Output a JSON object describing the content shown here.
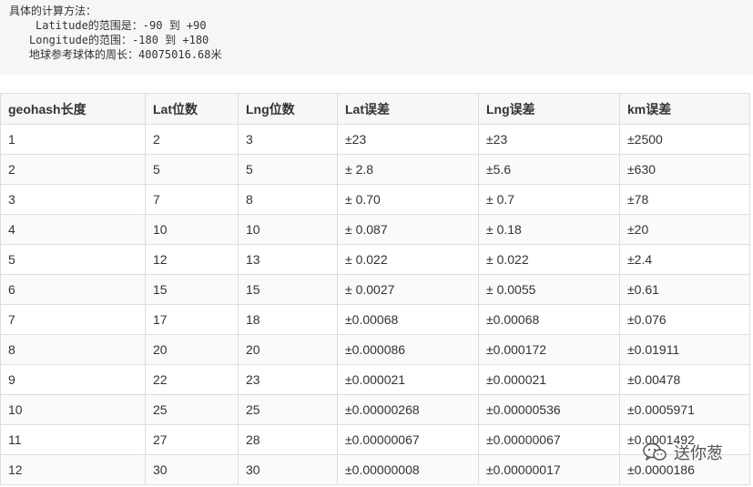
{
  "code_block": {
    "lines": [
      "具体的计算方法：",
      "Latitude的范围是：-90 到 +90",
      "Longitude的范围：-180 到 +180",
      "地球参考球体的周长：40075016.68米"
    ]
  },
  "table": {
    "headers": [
      "geohash长度",
      "Lat位数",
      "Lng位数",
      "Lat误差",
      "Lng误差",
      "km误差"
    ],
    "rows": [
      [
        "1",
        "2",
        "3",
        "±23",
        "±23",
        "±2500"
      ],
      [
        "2",
        "5",
        "5",
        "± 2.8",
        "±5.6",
        "±630"
      ],
      [
        "3",
        "7",
        "8",
        "± 0.70",
        "± 0.7",
        "±78"
      ],
      [
        "4",
        "10",
        "10",
        "± 0.087",
        "± 0.18",
        "±20"
      ],
      [
        "5",
        "12",
        "13",
        "± 0.022",
        "± 0.022",
        "±2.4"
      ],
      [
        "6",
        "15",
        "15",
        "± 0.0027",
        "± 0.0055",
        "±0.61"
      ],
      [
        "7",
        "17",
        "18",
        "±0.00068",
        "±0.00068",
        "±0.076"
      ],
      [
        "8",
        "20",
        "20",
        "±0.000086",
        "±0.000172",
        "±0.01911"
      ],
      [
        "9",
        "22",
        "23",
        "±0.000021",
        "±0.000021",
        "±0.00478"
      ],
      [
        "10",
        "25",
        "25",
        "±0.00000268",
        "±0.00000536",
        "±0.0005971"
      ],
      [
        "11",
        "27",
        "28",
        "±0.00000067",
        "±0.00000067",
        "±0.0001492"
      ],
      [
        "12",
        "30",
        "30",
        "±0.00000008",
        "±0.00000017",
        "±0.0000186"
      ]
    ]
  },
  "watermark": {
    "text": "送你葱",
    "icon": "wechat-icon"
  }
}
